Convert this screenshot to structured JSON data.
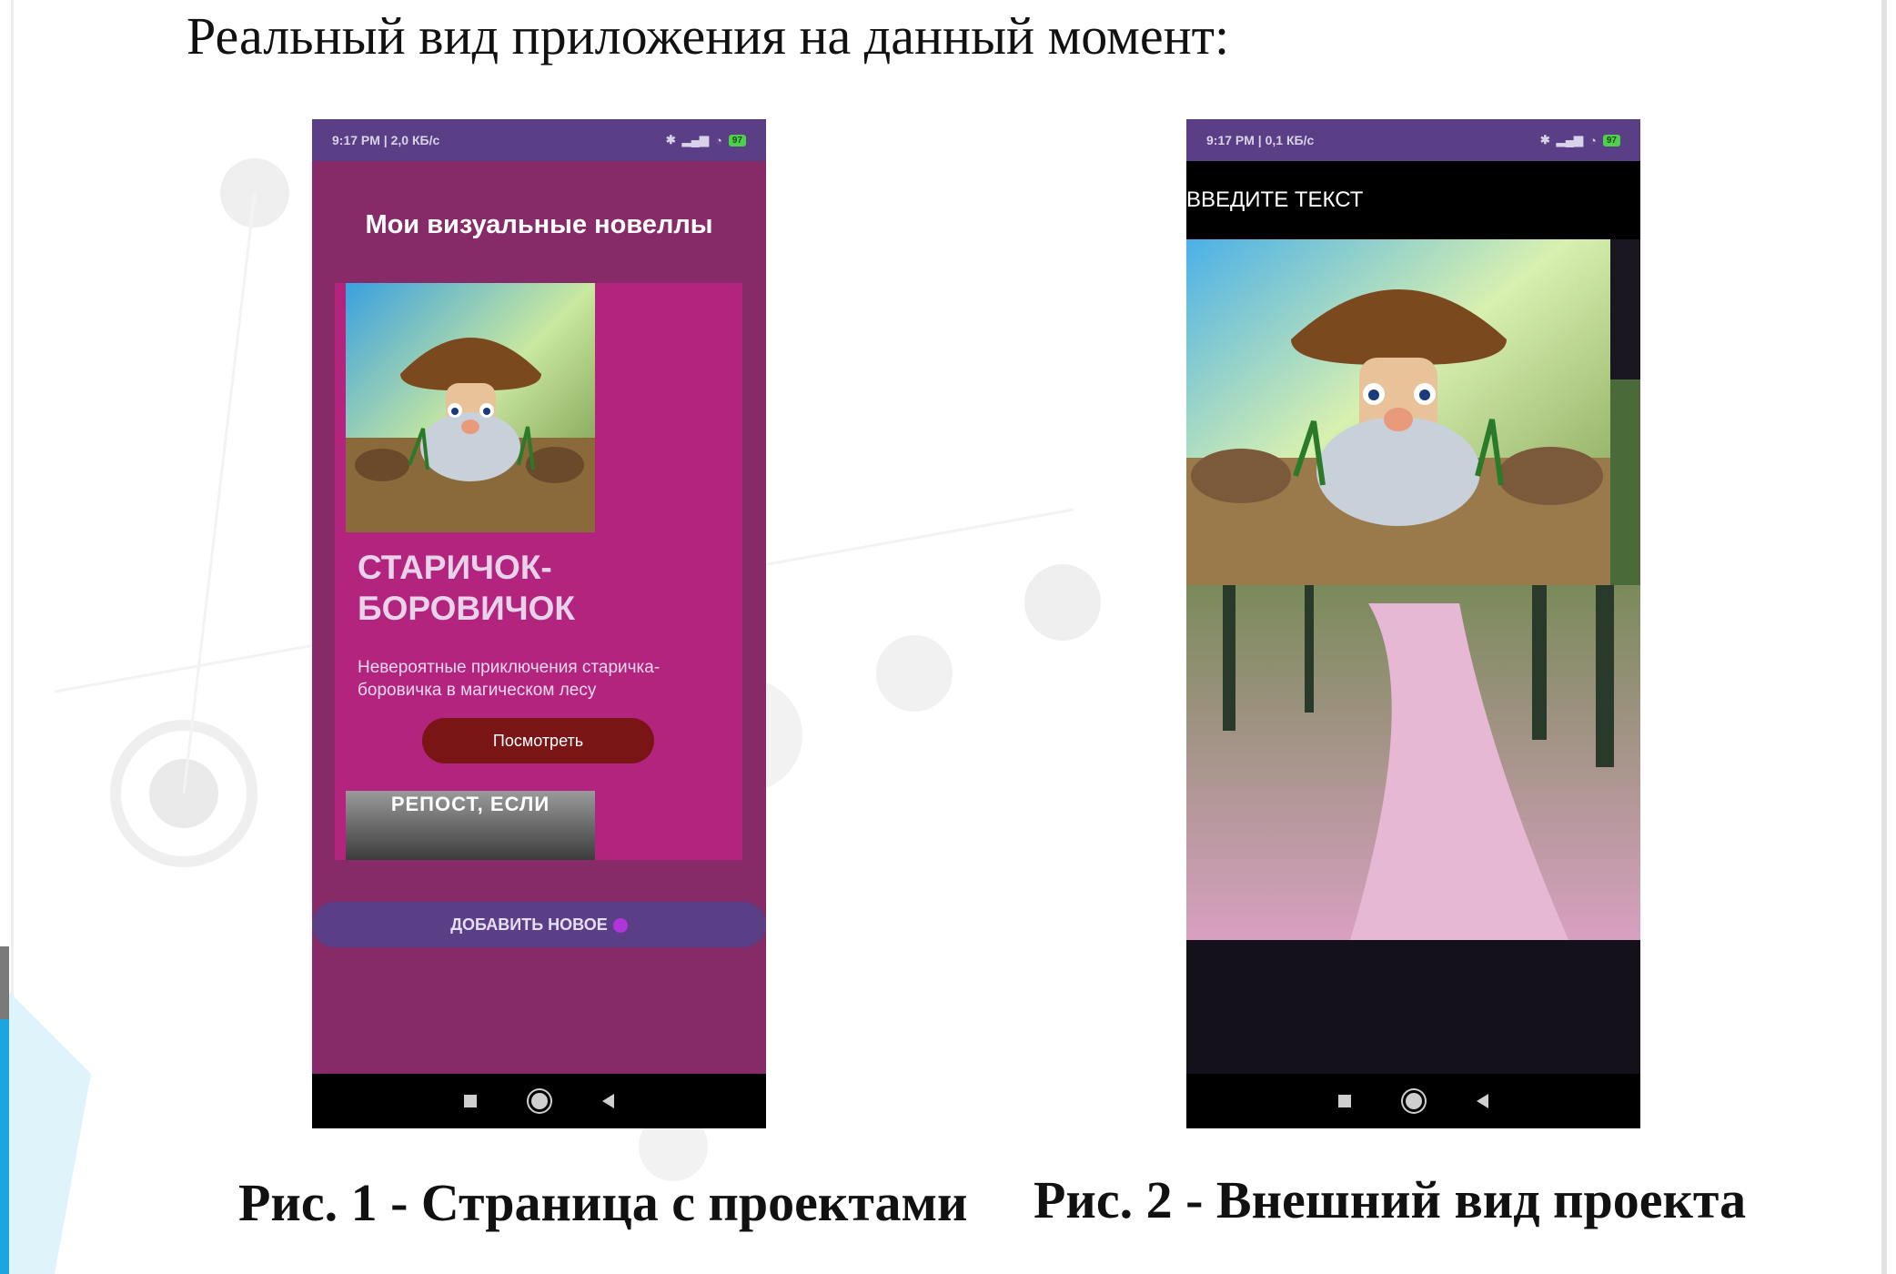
{
  "slide": {
    "title": "Реальный вид приложения на данный момент:",
    "caption1": "Рис. 1 - Страница с проектами",
    "caption2": "Рис. 2 - Внешний вид проекта"
  },
  "phone1": {
    "status_left": "9:17 PM | 2,0 КБ/с",
    "battery": "97",
    "header": "Мои визуальные новеллы",
    "card": {
      "title": "СТАРИЧОК-БОРОВИЧОК",
      "description": "Невероятные приключения старичка-боровичка в магическом лесу",
      "button": "Посмотреть"
    },
    "card2_text": "РЕПОСТ, ЕСЛИ",
    "add_button": "ДОБАВИТЬ НОВОЕ",
    "accent": "#b3247f"
  },
  "phone2": {
    "status_left": "9:17 PM | 0,1 КБ/с",
    "battery": "97",
    "toolbar_text": "ВВЕДИТЕ ТЕКСТ"
  },
  "icons": [
    "moon-icon",
    "bluetooth-icon",
    "signal-icon",
    "wifi-icon",
    "battery-icon",
    "nav-recents-icon",
    "nav-home-icon",
    "nav-back-icon"
  ]
}
